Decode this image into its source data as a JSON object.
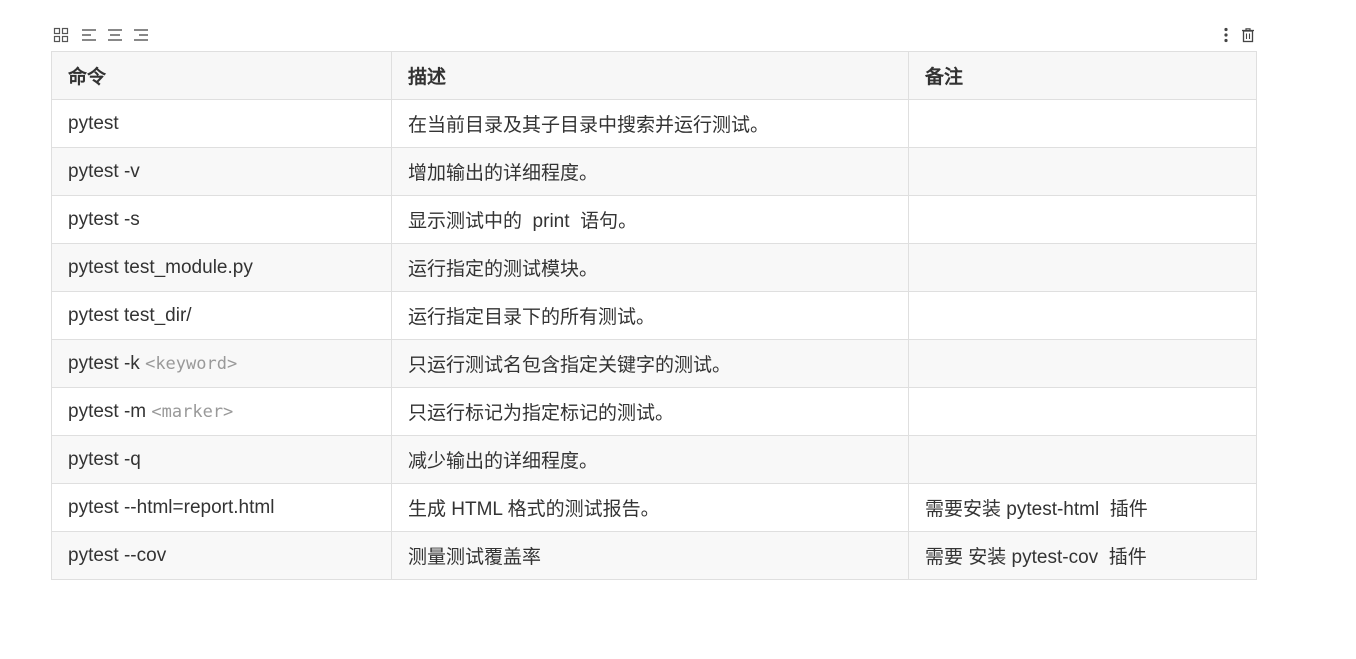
{
  "toolbar": {
    "left_icons": [
      "grid-icon",
      "align-left-icon",
      "align-center-icon",
      "align-right-icon"
    ],
    "right_icons": [
      "more-vertical-icon",
      "trash-icon"
    ]
  },
  "table": {
    "headers": [
      "命令",
      "描述",
      "备注"
    ],
    "rows": [
      {
        "command": "pytest",
        "command_arg": "",
        "description": "在当前目录及其子目录中搜索并运行测试。",
        "note": ""
      },
      {
        "command": "pytest -v",
        "command_arg": "",
        "description": "增加输出的详细程度。",
        "note": ""
      },
      {
        "command": "pytest -s",
        "command_arg": "",
        "description": "显示测试中的  print  语句。",
        "note": ""
      },
      {
        "command": "pytest test_module.py",
        "command_arg": "",
        "description": "运行指定的测试模块。",
        "note": ""
      },
      {
        "command": "pytest test_dir/",
        "command_arg": "",
        "description": "运行指定目录下的所有测试。",
        "note": ""
      },
      {
        "command": "pytest -k ",
        "command_arg": "<keyword>",
        "description": "只运行测试名包含指定关键字的测试。",
        "note": ""
      },
      {
        "command": "pytest -m ",
        "command_arg": "<marker>",
        "description": "只运行标记为指定标记的测试。",
        "note": ""
      },
      {
        "command": "pytest -q",
        "command_arg": "",
        "description": "减少输出的详细程度。",
        "note": ""
      },
      {
        "command": "pytest --html=report.html",
        "command_arg": "",
        "description": "生成 HTML 格式的测试报告。",
        "note": "需要安装 pytest-html  插件"
      },
      {
        "command": "pytest --cov",
        "command_arg": "",
        "description": "测量测试覆盖率",
        "note": "需要 安装 pytest-cov  插件"
      }
    ]
  }
}
